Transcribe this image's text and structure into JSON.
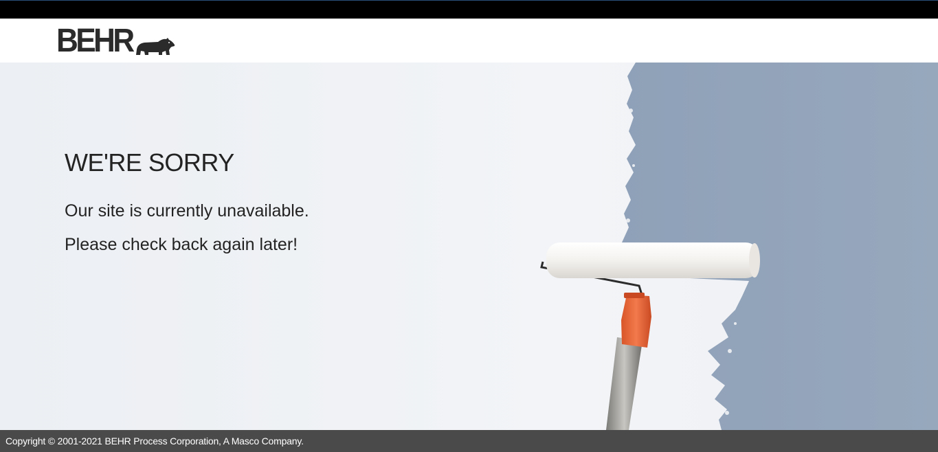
{
  "brand": {
    "logo_text": "BEHR",
    "logo_icon": "bear-icon"
  },
  "message": {
    "heading": "WE'RE SORRY",
    "line1": "Our site is currently unavailable.",
    "line2": "Please check back again later!"
  },
  "hero": {
    "image": "paint-roller-wall-image",
    "colors": {
      "white_wall": "#eef0f4",
      "painted_wall": "#94a5bc",
      "roller_handle": "#e8643a"
    }
  },
  "footer": {
    "copyright": "Copyright © 2001-2021 BEHR Process Corporation, A Masco Company."
  },
  "colors": {
    "top_bar": "#000000",
    "header_bg": "#ffffff",
    "footer_bg": "#4a4a4a",
    "text": "#232323"
  }
}
